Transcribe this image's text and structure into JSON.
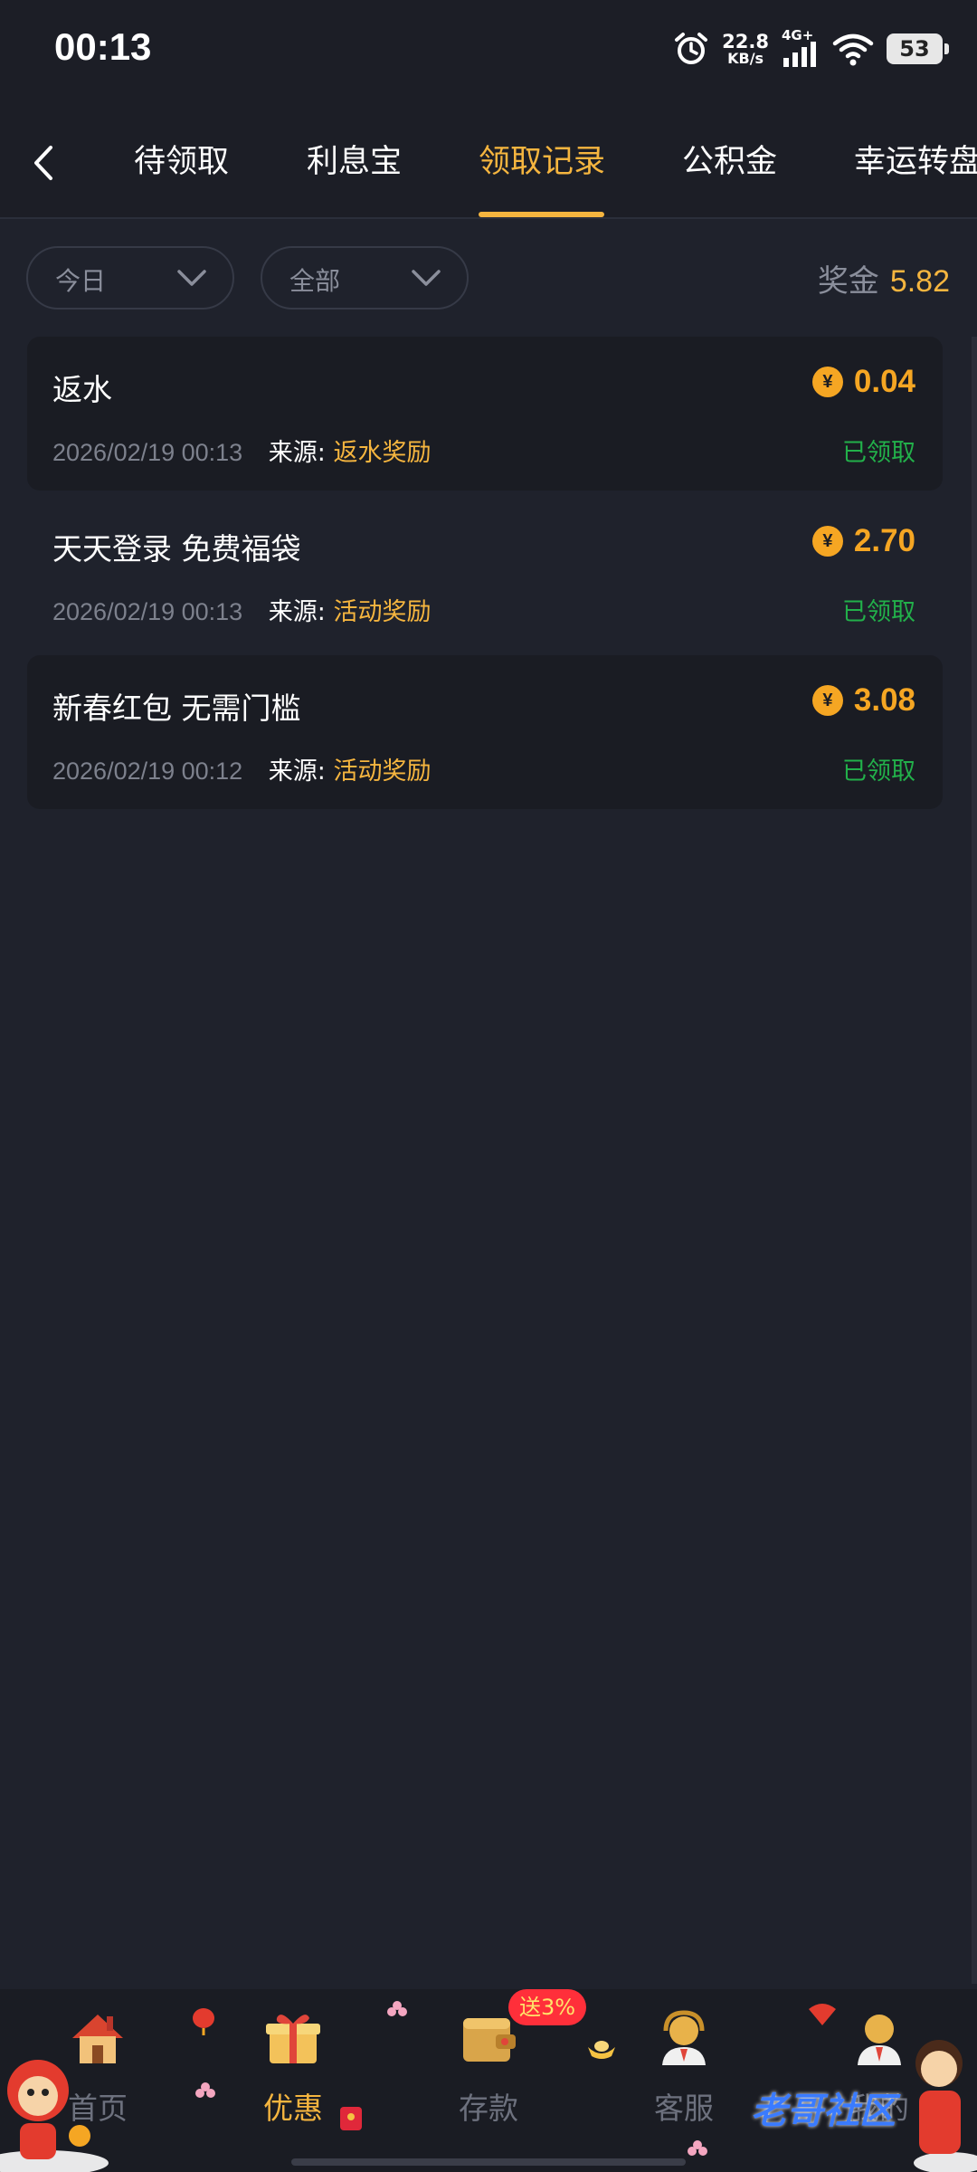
{
  "status_bar": {
    "time": "00:13",
    "net_speed_value": "22.8",
    "net_speed_unit": "KB/s",
    "signal_label": "4G+",
    "battery": "53"
  },
  "tabs": [
    {
      "label": "待领取"
    },
    {
      "label": "利息宝"
    },
    {
      "label": "领取记录"
    },
    {
      "label": "公积金"
    },
    {
      "label": "幸运转盘"
    }
  ],
  "active_tab": 2,
  "filters": {
    "date": "今日",
    "type": "全部"
  },
  "bonus": {
    "label": "奖金",
    "amount": "5.82"
  },
  "coin_symbol": "¥",
  "records": [
    {
      "title": "返水",
      "amount": "0.04",
      "date": "2026/02/19 00:13",
      "source_label": "来源:",
      "source": "返水奖励",
      "status": "已领取"
    },
    {
      "title": "天天登录 免费福袋",
      "amount": "2.70",
      "date": "2026/02/19 00:13",
      "source_label": "来源:",
      "source": "活动奖励",
      "status": "已领取"
    },
    {
      "title": "新春红包 无需门槛",
      "amount": "3.08",
      "date": "2026/02/19 00:12",
      "source_label": "来源:",
      "source": "活动奖励",
      "status": "已领取"
    }
  ],
  "bottom_nav": [
    {
      "label": "首页",
      "icon": "house-icon"
    },
    {
      "label": "优惠",
      "icon": "gift-icon"
    },
    {
      "label": "存款",
      "icon": "wallet-icon"
    },
    {
      "label": "客服",
      "icon": "support-agent-icon"
    },
    {
      "label": "我的",
      "icon": "user-icon"
    }
  ],
  "deposit_badge": "送3%",
  "watermark": "老哥社区",
  "colors": {
    "accent": "#f5b53f",
    "amount": "#f5a623",
    "status_claimed": "#22b04a",
    "background": "#1f222c"
  }
}
